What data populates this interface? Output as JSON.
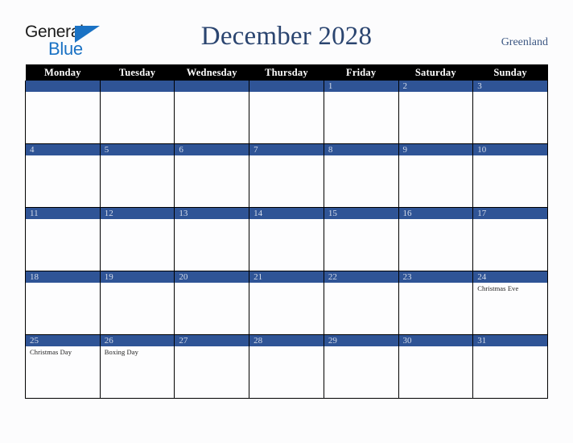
{
  "brand": {
    "word_one": "General",
    "word_two": "Blue",
    "triangle_icon": "triangle-icon",
    "black_hex": "#1b1b1b",
    "blue_hex": "#1a72c4"
  },
  "header": {
    "title": "December 2028",
    "region": "Greenland",
    "title_color_hex": "#2b4570"
  },
  "calendar": {
    "weekday_headers": [
      "Monday",
      "Tuesday",
      "Wednesday",
      "Thursday",
      "Friday",
      "Saturday",
      "Sunday"
    ],
    "header_bg_hex": "#000000",
    "header_text_hex": "#ffffff",
    "daybar_bg_hex": "#2f5496",
    "daybar_text_hex": "#d5dcea",
    "cell_bg_hex": "#fdfdfe",
    "border_hex": "#000000",
    "weeks": [
      [
        {
          "date": "",
          "events": []
        },
        {
          "date": "",
          "events": []
        },
        {
          "date": "",
          "events": []
        },
        {
          "date": "",
          "events": []
        },
        {
          "date": "1",
          "events": []
        },
        {
          "date": "2",
          "events": []
        },
        {
          "date": "3",
          "events": []
        }
      ],
      [
        {
          "date": "4",
          "events": []
        },
        {
          "date": "5",
          "events": []
        },
        {
          "date": "6",
          "events": []
        },
        {
          "date": "7",
          "events": []
        },
        {
          "date": "8",
          "events": []
        },
        {
          "date": "9",
          "events": []
        },
        {
          "date": "10",
          "events": []
        }
      ],
      [
        {
          "date": "11",
          "events": []
        },
        {
          "date": "12",
          "events": []
        },
        {
          "date": "13",
          "events": []
        },
        {
          "date": "14",
          "events": []
        },
        {
          "date": "15",
          "events": []
        },
        {
          "date": "16",
          "events": []
        },
        {
          "date": "17",
          "events": []
        }
      ],
      [
        {
          "date": "18",
          "events": []
        },
        {
          "date": "19",
          "events": []
        },
        {
          "date": "20",
          "events": []
        },
        {
          "date": "21",
          "events": []
        },
        {
          "date": "22",
          "events": []
        },
        {
          "date": "23",
          "events": []
        },
        {
          "date": "24",
          "events": [
            "Christmas Eve"
          ]
        }
      ],
      [
        {
          "date": "25",
          "events": [
            "Christmas Day"
          ]
        },
        {
          "date": "26",
          "events": [
            "Boxing Day"
          ]
        },
        {
          "date": "27",
          "events": []
        },
        {
          "date": "28",
          "events": []
        },
        {
          "date": "29",
          "events": []
        },
        {
          "date": "30",
          "events": []
        },
        {
          "date": "31",
          "events": []
        }
      ]
    ]
  }
}
